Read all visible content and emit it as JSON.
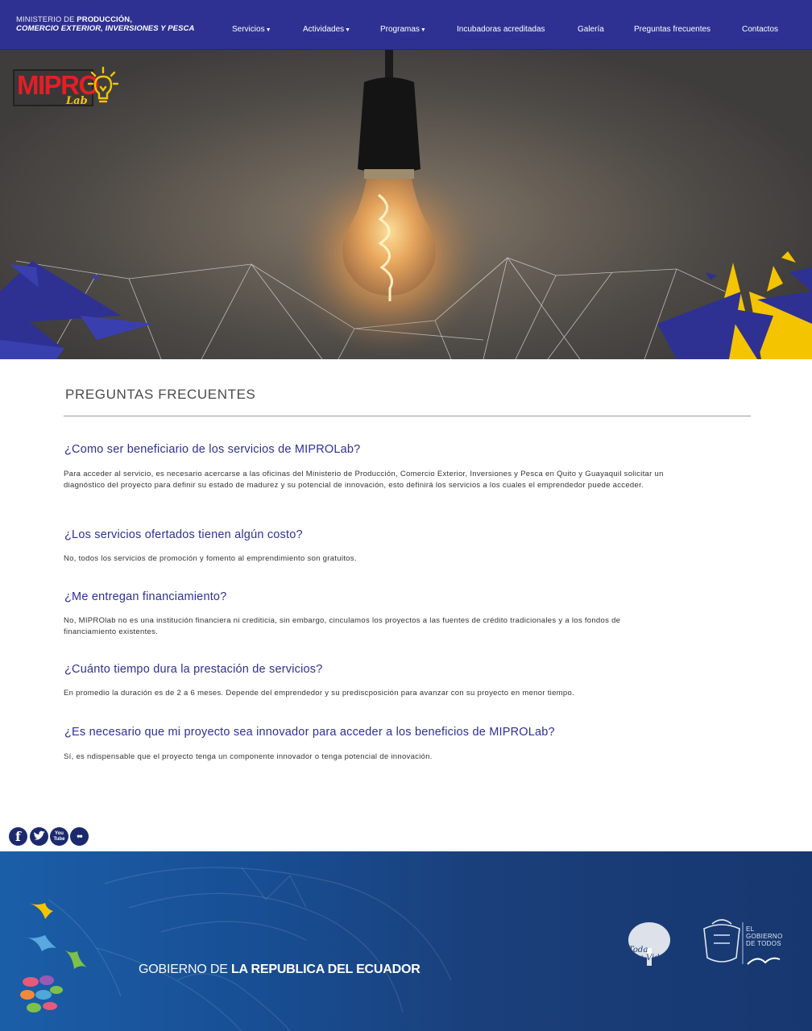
{
  "header": {
    "ministry_line1_thin": "MINISTERIO DE ",
    "ministry_line1_bold": "PRODUCCIÓN,",
    "ministry_line2": "COMERCIO EXTERIOR, INVERSIONES Y PESCA",
    "nav": [
      {
        "label": "Servicios",
        "has_dropdown": true
      },
      {
        "label": "Actividades",
        "has_dropdown": true
      },
      {
        "label": "Programas",
        "has_dropdown": true
      },
      {
        "label": "Incubadoras acreditadas",
        "has_dropdown": false
      },
      {
        "label": "Galería",
        "has_dropdown": false
      },
      {
        "label": "Preguntas frecuentes",
        "has_dropdown": false
      },
      {
        "label": "Contactos",
        "has_dropdown": false
      }
    ]
  },
  "hero": {
    "logo_text": "MIPRO",
    "logo_sub": "Lab",
    "icon": "lightbulb-icon"
  },
  "content": {
    "title": "PREGUNTAS FRECUENTES",
    "faqs": [
      {
        "question": "¿Como ser beneficiario de los servicios de MIPROLab?",
        "answer": "Para acceder al servicio, es necesario acercarse a las oficinas del Ministerio de Producción, Comercio Exterior, Inversiones y Pesca en Quito y Guayaquil solicitar un diagnóstico del proyecto para definir su estado de madurez y su potencial de innovación, esto definirá los servicios a los cuales el emprendedor puede acceder."
      },
      {
        "question": "¿Los servicios ofertados tienen algún costo?",
        "answer": "No, todos los servicios de promoción y fomento al emprendimiento son gratuitos."
      },
      {
        "question": "¿Me entregan financiamiento?",
        "answer": "No, MIPROlab no es una institución financiera ni crediticia, sin embargo, cinculamos los proyectos a las fuentes de crédito tradicionales y a los fondos de financiamiento existentes."
      },
      {
        "question": "¿Cuánto tiempo dura la prestación de servicios?",
        "answer": "En promedio la duración es de 2 a 6 meses. Depende del emprendedor y su prediscposición para avanzar con su proyecto en menor tiempo."
      },
      {
        "question": "¿Es necesario que mi proyecto sea innovador para acceder a los beneficios de MIPROLab?",
        "answer": "Sí, es ndispensable que el proyecto tenga un componente innovador o tenga potencial de innovación."
      }
    ]
  },
  "social": [
    {
      "icon": "facebook-icon",
      "glyph": "f"
    },
    {
      "icon": "twitter-icon",
      "glyph": "t"
    },
    {
      "icon": "youtube-icon",
      "glyph": "You Tube"
    },
    {
      "icon": "flickr-icon",
      "glyph": "••"
    }
  ],
  "footer": {
    "gov_light": "GOBIERNO DE ",
    "gov_strong": "LA REPUBLICA DEL ECUADOR",
    "todo_line1": "Toda",
    "todo_line2": "una Vida",
    "elgob_line1": "EL",
    "elgob_line2": "GOBIERNO",
    "elgob_line3": "DE TODOS"
  },
  "colors": {
    "header_bg": "#2e3192",
    "question_color": "#2e3192",
    "logo_red": "#e41e26",
    "logo_yellow": "#f5c400",
    "footer_blue": "#184f95"
  }
}
